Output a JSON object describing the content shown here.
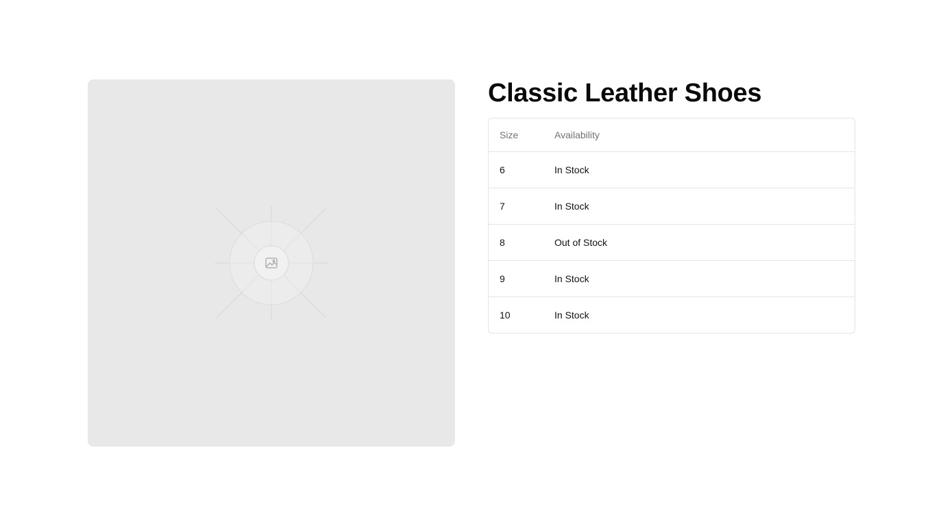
{
  "product": {
    "title": "Classic Leather Shoes",
    "image_icon": "image-placeholder-icon"
  },
  "size_table": {
    "headers": {
      "size": "Size",
      "availability": "Availability"
    },
    "rows": [
      {
        "size": "6",
        "availability": "In Stock"
      },
      {
        "size": "7",
        "availability": "In Stock"
      },
      {
        "size": "8",
        "availability": "Out of Stock"
      },
      {
        "size": "9",
        "availability": "In Stock"
      },
      {
        "size": "10",
        "availability": "In Stock"
      }
    ]
  },
  "colors": {
    "image_background": "#e8e8e8",
    "table_border": "#e4e4e7",
    "header_text": "#71717a"
  }
}
